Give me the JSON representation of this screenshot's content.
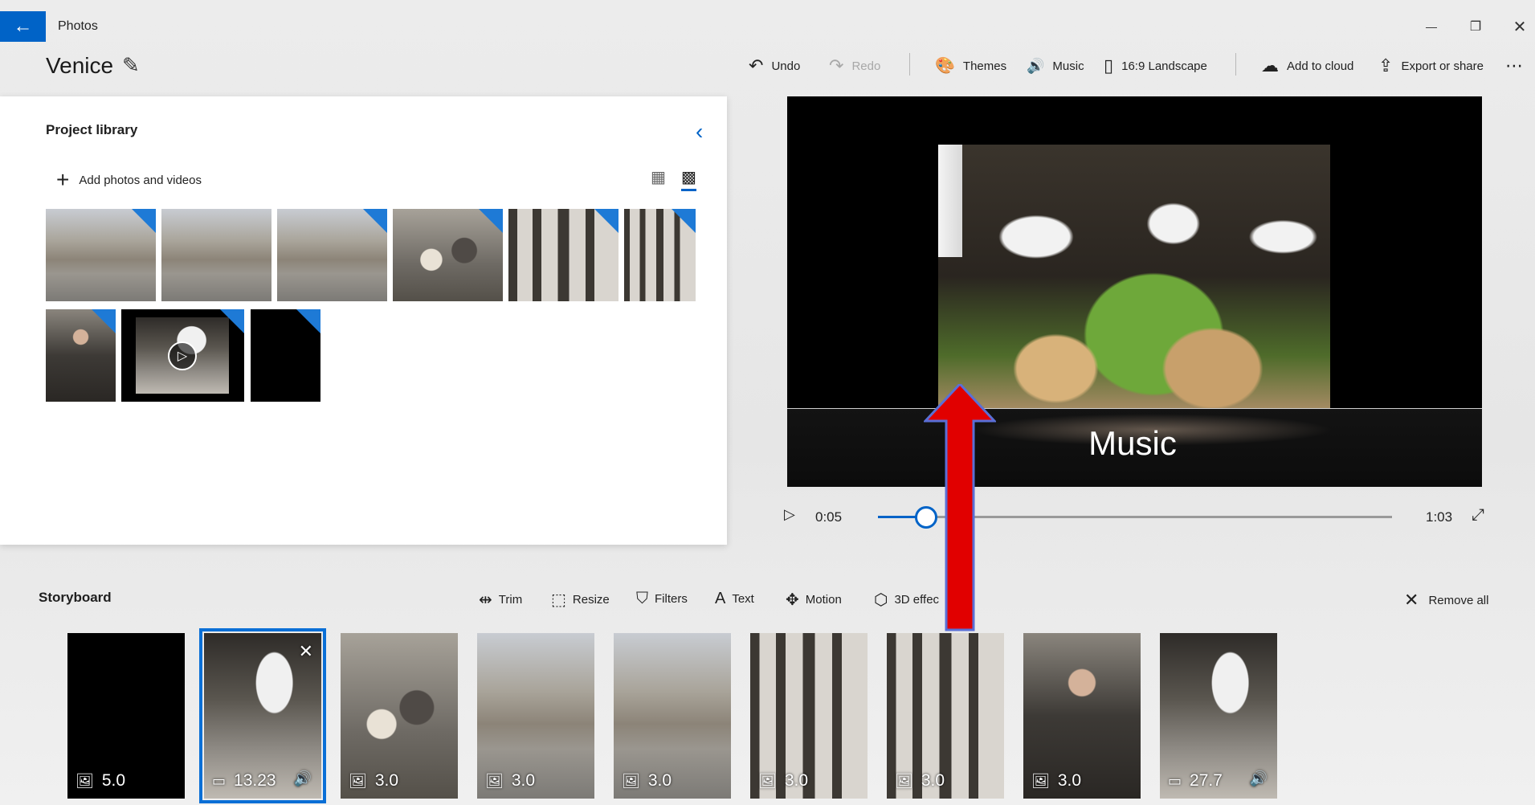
{
  "window": {
    "app_name": "Photos",
    "back_icon": "←",
    "minimize_icon": "—",
    "restore_icon": "❐",
    "close_icon": "✕"
  },
  "header": {
    "project_title": "Venice",
    "edit_icon": "✎"
  },
  "toolbar": {
    "undo": {
      "label": "Undo",
      "icon": "↶"
    },
    "redo": {
      "label": "Redo",
      "icon": "↷"
    },
    "themes": {
      "label": "Themes",
      "icon": "🎨"
    },
    "music": {
      "label": "Music",
      "icon": "🔊"
    },
    "aspect": {
      "label": "16:9 Landscape",
      "icon": "▯"
    },
    "cloud": {
      "label": "Add to cloud",
      "icon": "☁"
    },
    "export": {
      "label": "Export or share",
      "icon": "⇪"
    },
    "more_icon": "⋯"
  },
  "library": {
    "title": "Project library",
    "collapse_icon": "‹",
    "add_label": "Add photos and videos",
    "add_icon": "+",
    "view_large_icon": "▦",
    "view_small_icon": "▩",
    "play_icon": "▷"
  },
  "preview": {
    "caption": "Music",
    "play_icon": "▷",
    "time_current": "0:05",
    "time_total": "1:03",
    "progress": 0.094,
    "fullscreen_icon": "⤢"
  },
  "storyboard": {
    "title": "Storyboard",
    "tools": [
      {
        "label": "Trim",
        "icon": "⇹"
      },
      {
        "label": "Resize",
        "icon": "⬚"
      },
      {
        "label": "Filters",
        "icon": "⛉"
      },
      {
        "label": "Text",
        "icon": "A"
      },
      {
        "label": "Motion",
        "icon": "✥"
      },
      {
        "label": "3D effec",
        "icon": "⬡"
      }
    ],
    "remove_all": {
      "label": "Remove all",
      "icon": "✕"
    },
    "cards": [
      {
        "duration": "5.0",
        "kind_icon": "🖼"
      },
      {
        "duration": "13.23",
        "kind_icon": "▭",
        "audio_icon": "🔊",
        "close_icon": "✕"
      },
      {
        "duration": "3.0",
        "kind_icon": "🖼"
      },
      {
        "duration": "3.0",
        "kind_icon": "🖼"
      },
      {
        "duration": "3.0",
        "kind_icon": "🖼"
      },
      {
        "duration": "3.0",
        "kind_icon": "🖼"
      },
      {
        "duration": "3.0",
        "kind_icon": "🖼"
      },
      {
        "duration": "3.0",
        "kind_icon": "🖼"
      },
      {
        "duration": "27.7",
        "kind_icon": "▭",
        "audio_icon": "🔊"
      }
    ]
  },
  "colors": {
    "accent": "#0063c7",
    "annotation_arrow": "#e10000"
  }
}
